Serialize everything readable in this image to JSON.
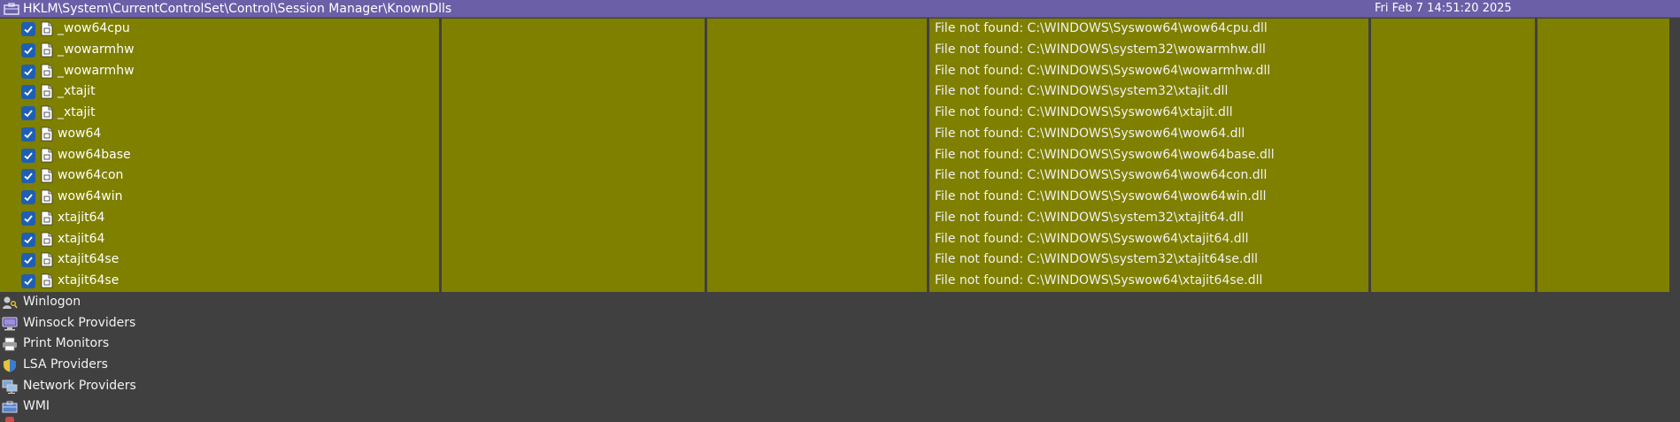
{
  "header": {
    "path": "HKLM\\System\\CurrentControlSet\\Control\\Session Manager\\KnownDlls",
    "timestamp": "Fri Feb  7 14:51:20 2025",
    "icon": "registry-icon"
  },
  "rows": [
    {
      "name": "_wow64cpu",
      "status": "File not found: C:\\WINDOWS\\Syswow64\\wow64cpu.dll",
      "checked": true
    },
    {
      "name": "_wowarmhw",
      "status": "File not found: C:\\WINDOWS\\system32\\wowarmhw.dll",
      "checked": true
    },
    {
      "name": "_wowarmhw",
      "status": "File not found: C:\\WINDOWS\\Syswow64\\wowarmhw.dll",
      "checked": true
    },
    {
      "name": "_xtajit",
      "status": "File not found: C:\\WINDOWS\\system32\\xtajit.dll",
      "checked": true
    },
    {
      "name": "_xtajit",
      "status": "File not found: C:\\WINDOWS\\Syswow64\\xtajit.dll",
      "checked": true
    },
    {
      "name": "wow64",
      "status": "File not found: C:\\WINDOWS\\Syswow64\\wow64.dll",
      "checked": true
    },
    {
      "name": "wow64base",
      "status": "File not found: C:\\WINDOWS\\Syswow64\\wow64base.dll",
      "checked": true
    },
    {
      "name": "wow64con",
      "status": "File not found: C:\\WINDOWS\\Syswow64\\wow64con.dll",
      "checked": true
    },
    {
      "name": "wow64win",
      "status": "File not found: C:\\WINDOWS\\Syswow64\\wow64win.dll",
      "checked": true
    },
    {
      "name": "xtajit64",
      "status": "File not found: C:\\WINDOWS\\system32\\xtajit64.dll",
      "checked": true
    },
    {
      "name": "xtajit64",
      "status": "File not found: C:\\WINDOWS\\Syswow64\\xtajit64.dll",
      "checked": true
    },
    {
      "name": "xtajit64se",
      "status": "File not found: C:\\WINDOWS\\system32\\xtajit64se.dll",
      "checked": true
    },
    {
      "name": "xtajit64se",
      "status": "File not found: C:\\WINDOWS\\Syswow64\\xtajit64se.dll",
      "checked": true
    }
  ],
  "categories": [
    {
      "label": "Winlogon",
      "icon": "winlogon-icon"
    },
    {
      "label": "Winsock Providers",
      "icon": "winsock-icon"
    },
    {
      "label": "Print Monitors",
      "icon": "printer-icon"
    },
    {
      "label": "LSA Providers",
      "icon": "shield-icon"
    },
    {
      "label": "Network Providers",
      "icon": "network-icon"
    },
    {
      "label": "WMI",
      "icon": "wmi-icon"
    }
  ],
  "colors": {
    "header_bg": "#6b5fa8",
    "row_highlight": "#7f7f00",
    "background": "#404040",
    "checkbox": "#1f5fb3"
  }
}
